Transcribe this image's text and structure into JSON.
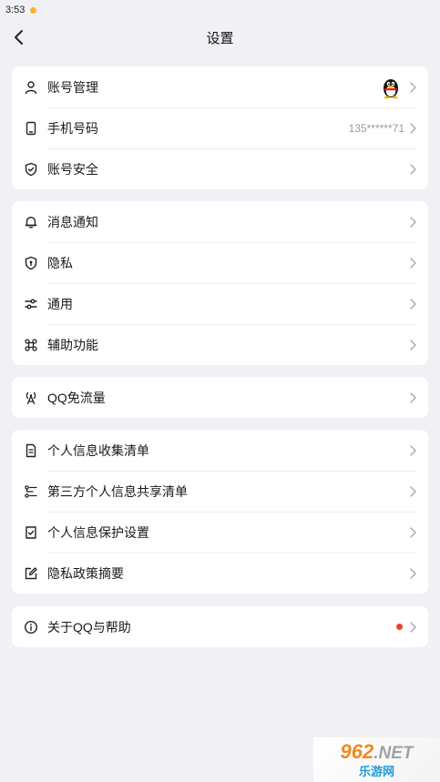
{
  "status_bar": {
    "time": "3:53"
  },
  "header": {
    "title": "设置"
  },
  "group1": [
    {
      "label": "账号管理",
      "icon": "person-icon"
    },
    {
      "label": "手机号码",
      "value": "135******71",
      "icon": "phone-icon"
    },
    {
      "label": "账号安全",
      "icon": "shield-check-icon"
    }
  ],
  "group2": [
    {
      "label": "消息通知",
      "icon": "bell-icon"
    },
    {
      "label": "隐私",
      "icon": "privacy-shield-icon"
    },
    {
      "label": "通用",
      "icon": "sliders-icon"
    },
    {
      "label": "辅助功能",
      "icon": "command-icon"
    }
  ],
  "group3": [
    {
      "label": "QQ免流量",
      "icon": "signal-tower-icon"
    }
  ],
  "group4": [
    {
      "label": "个人信息收集清单",
      "icon": "document-icon"
    },
    {
      "label": "第三方个人信息共享清单",
      "icon": "share-list-icon"
    },
    {
      "label": "个人信息保护设置",
      "icon": "check-box-icon"
    },
    {
      "label": "隐私政策摘要",
      "icon": "edit-icon"
    }
  ],
  "group5": [
    {
      "label": "关于QQ与帮助",
      "icon": "info-icon"
    }
  ],
  "watermark": {
    "top": "962",
    "net": ".NET",
    "bottom": "乐游网"
  },
  "colors": {
    "background": "#F1F1F5",
    "card": "#FFFFFF",
    "badge": "#F0402A"
  }
}
